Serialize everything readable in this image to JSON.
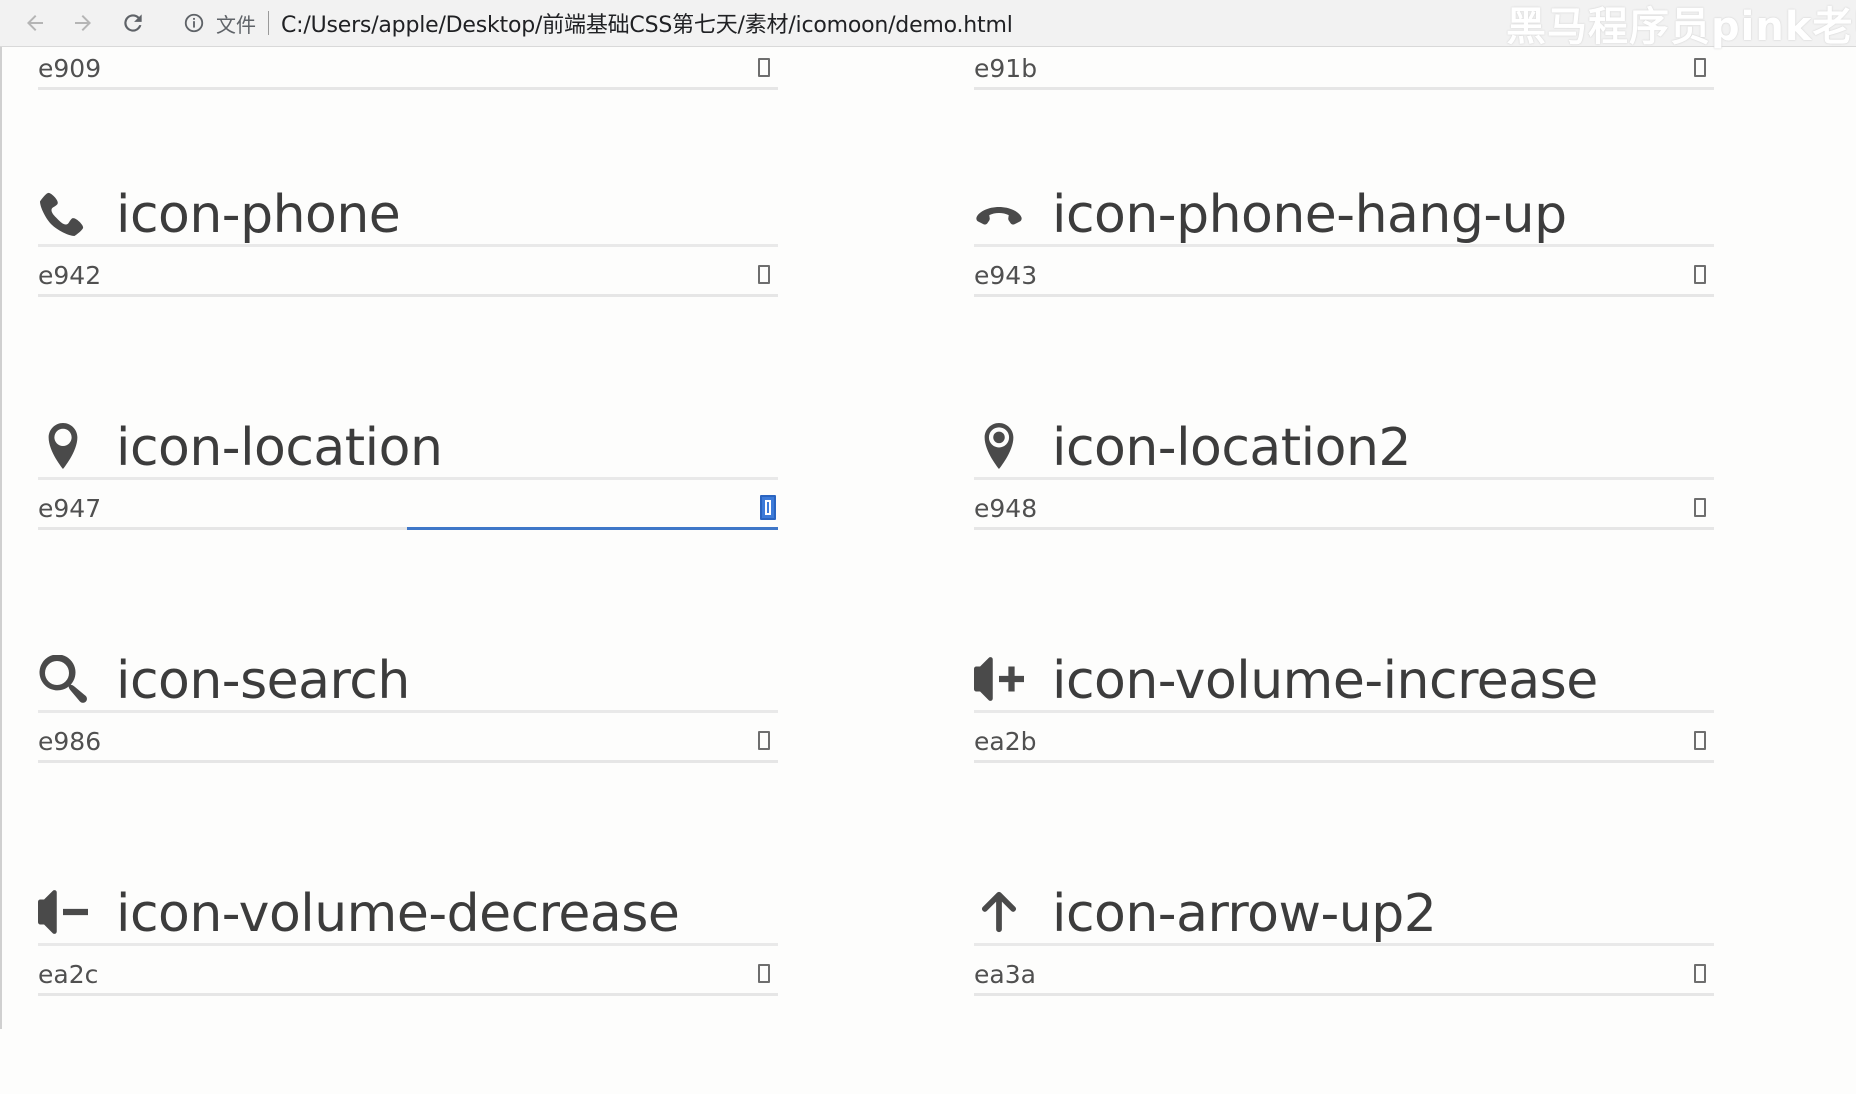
{
  "browser": {
    "file_label": "文件",
    "url": "C:/Users/apple/Desktop/前端基础CSS第七天/素材/icomoon/demo.html",
    "watermark": "黑马程序员pink老师"
  },
  "top_codes": [
    {
      "code": "e909"
    },
    {
      "code": "e91b"
    }
  ],
  "glyphs": [
    {
      "icon": "phone-icon",
      "name": "icon-phone",
      "code": "e942"
    },
    {
      "icon": "phone-hang-up-icon",
      "name": "icon-phone-hang-up",
      "code": "e943"
    },
    {
      "icon": "location-icon",
      "name": "icon-location",
      "code": "e947",
      "selected": true
    },
    {
      "icon": "location2-icon",
      "name": "icon-location2",
      "code": "e948"
    },
    {
      "icon": "search-icon",
      "name": "icon-search",
      "code": "e986"
    },
    {
      "icon": "volume-increase-icon",
      "name": "icon-volume-increase",
      "code": "ea2b"
    },
    {
      "icon": "volume-decrease-icon",
      "name": "icon-volume-decrease",
      "code": "ea2c"
    },
    {
      "icon": "arrow-up2-icon",
      "name": "icon-arrow-up2",
      "code": "ea3a"
    }
  ],
  "colors": {
    "icon": "#4a4a4a",
    "selection": "#3d7bd9",
    "divider": "#e9e9e9"
  }
}
